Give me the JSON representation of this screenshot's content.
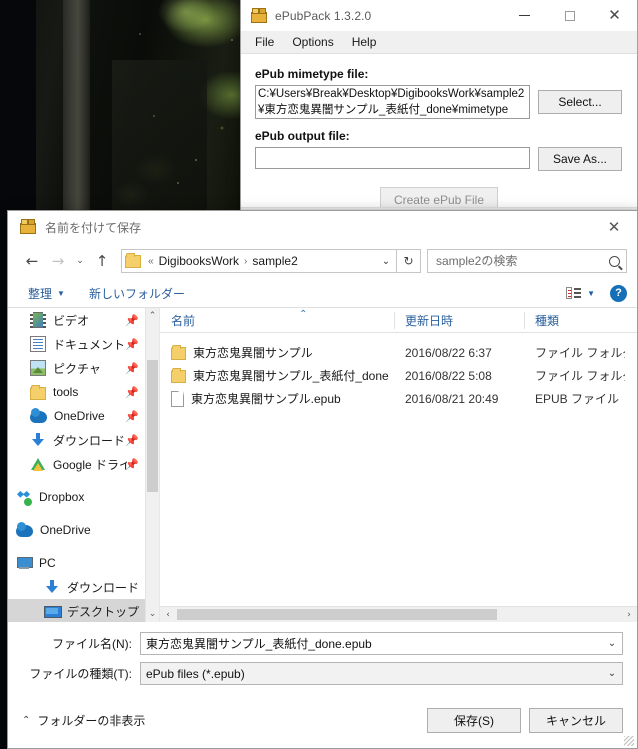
{
  "desktop": {
    "wallpaper_name": "dark-forest-photo"
  },
  "epubpack": {
    "title": "ePubPack 1.3.2.0",
    "icon": "package-icon",
    "window_buttons": {
      "minimize": "—",
      "maximize": "□",
      "close": "✕"
    },
    "menu": [
      "File",
      "Options",
      "Help"
    ],
    "mimetype_label": "ePub mimetype file:",
    "mimetype_value": "C:¥Users¥Break¥Desktop¥DigibooksWork¥sample2¥東方恋鬼異闇サンプル_表紙付_done¥mimetype",
    "select_button": "Select...",
    "output_label": "ePub output file:",
    "output_value": "",
    "saveas_button": "Save As...",
    "create_button": "Create ePub File"
  },
  "saveas": {
    "title": "名前を付けて保存",
    "icon": "package-icon",
    "close": "✕",
    "nav": {
      "back": "←",
      "forward": "→",
      "recent": "⌄",
      "up": "↑"
    },
    "address": {
      "prefix": "«",
      "crumbs": [
        "DigibooksWork",
        "sample2"
      ],
      "separator": "›",
      "dropdown": "⌄",
      "refresh": "↻"
    },
    "search": {
      "placeholder": "sample2の検索",
      "value": "",
      "icon": "search-icon"
    },
    "toolbar": {
      "organize": "整理",
      "organize_caret": "▼",
      "new_folder": "新しいフォルダー",
      "view_caret": "▼",
      "help": "?"
    },
    "sidebar": {
      "quick_access": [
        {
          "label": "ビデオ",
          "icon": "video-icon",
          "pinned": true
        },
        {
          "label": "ドキュメント",
          "icon": "document-icon",
          "pinned": true
        },
        {
          "label": "ピクチャ",
          "icon": "pictures-icon",
          "pinned": true
        },
        {
          "label": "tools",
          "icon": "folder-icon",
          "pinned": true
        },
        {
          "label": "OneDrive",
          "icon": "onedrive-icon",
          "pinned": true
        },
        {
          "label": "ダウンロード",
          "icon": "download-icon",
          "pinned": true
        },
        {
          "label": "Google ドライブ",
          "icon": "google-drive-icon",
          "pinned": true
        }
      ],
      "roots": [
        {
          "label": "Dropbox",
          "icon": "dropbox-icon"
        },
        {
          "label": "OneDrive",
          "icon": "onedrive-icon"
        },
        {
          "label": "PC",
          "icon": "pc-icon"
        }
      ],
      "pc_children": [
        {
          "label": "ダウンロード",
          "icon": "download-icon",
          "selected": false
        },
        {
          "label": "デスクトップ",
          "icon": "desktop-icon",
          "selected": true
        }
      ],
      "pin_glyph": "📌",
      "scroll_up": "⌃",
      "scroll_down": "⌄"
    },
    "filelist": {
      "columns": [
        "名前",
        "更新日時",
        "種類"
      ],
      "sort_indicator": "⌃",
      "rows": [
        {
          "name": "東方恋鬼異闇サンプル",
          "date": "2016/08/22 6:37",
          "type": "ファイル フォルダー",
          "icon": "folder-icon"
        },
        {
          "name": "東方恋鬼異闇サンプル_表紙付_done",
          "date": "2016/08/22 5:08",
          "type": "ファイル フォルダー",
          "icon": "folder-icon"
        },
        {
          "name": "東方恋鬼異闇サンプル.epub",
          "date": "2016/08/21 20:49",
          "type": "EPUB ファイル",
          "icon": "file-icon"
        }
      ],
      "hscroll_left": "‹",
      "hscroll_right": "›"
    },
    "form": {
      "filename_label": "ファイル名(N):",
      "filename_value": "東方恋鬼異闇サンプル_表紙付_done.epub",
      "filetype_label": "ファイルの種類(T):",
      "filetype_value": "ePub files (*.epub)",
      "dropdown_glyph": "⌄"
    },
    "footer": {
      "hide_folders": "フォルダーの非表示",
      "hide_folders_chev": "⌃",
      "save_button": "保存(S)",
      "cancel_button": "キャンセル"
    }
  },
  "colors": {
    "accent_link": "#2b5f9e",
    "selection": "#d6d6d6",
    "help_blue": "#1570b8",
    "folder_yellow": "#f5d06a"
  }
}
